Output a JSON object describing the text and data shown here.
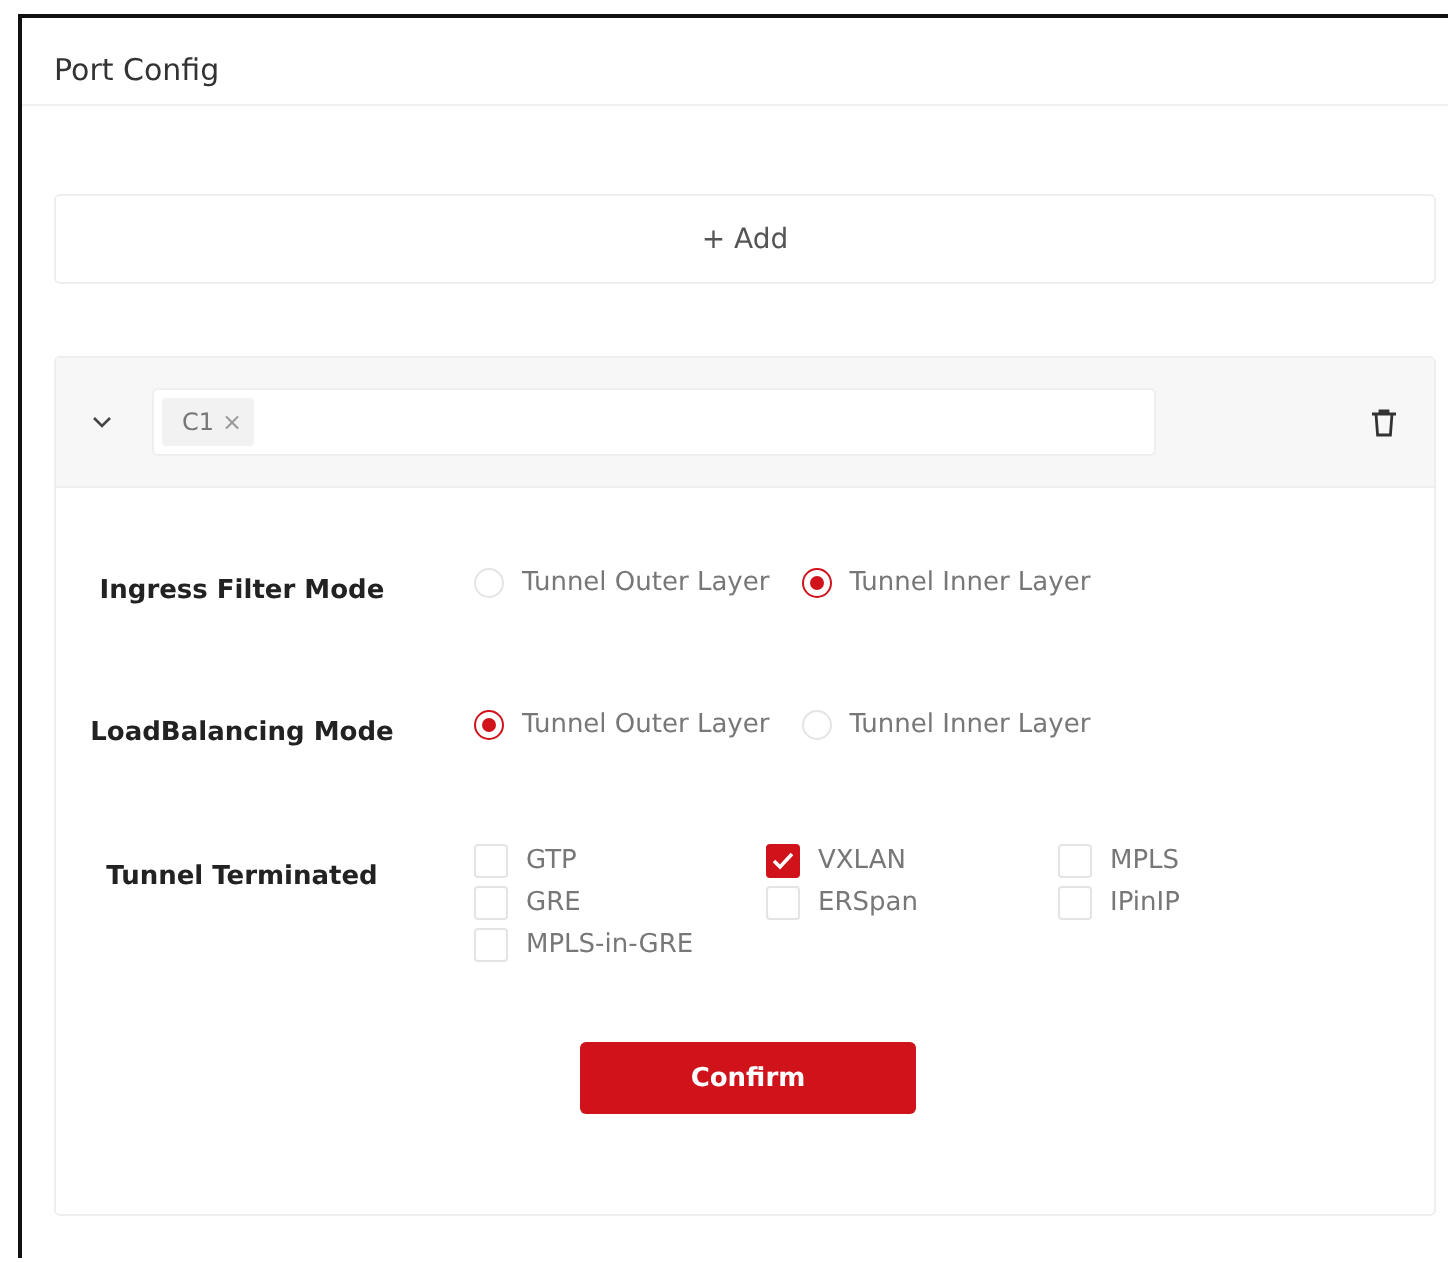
{
  "window": {
    "title": "Port Config"
  },
  "add_button": {
    "label": "+ Add"
  },
  "port_card": {
    "expanded": true,
    "tags": [
      {
        "label": "C1",
        "remove": "×"
      }
    ],
    "fields": [
      {
        "kind": "radio",
        "label": "Ingress Filter Mode",
        "options": [
          {
            "label": "Tunnel Outer Layer",
            "selected": false
          },
          {
            "label": "Tunnel Inner Layer",
            "selected": true
          }
        ]
      },
      {
        "kind": "radio",
        "label": "LoadBalancing Mode",
        "options": [
          {
            "label": "Tunnel Outer Layer",
            "selected": true
          },
          {
            "label": "Tunnel Inner Layer",
            "selected": false
          }
        ]
      },
      {
        "kind": "checkbox",
        "label": "Tunnel Terminated",
        "options": [
          {
            "label": "GTP",
            "checked": false
          },
          {
            "label": "VXLAN",
            "checked": true
          },
          {
            "label": "MPLS",
            "checked": false
          },
          {
            "label": "GRE",
            "checked": false
          },
          {
            "label": "ERSpan",
            "checked": false
          },
          {
            "label": "IPinIP",
            "checked": false
          },
          {
            "label": "MPLS-in-GRE",
            "checked": false
          }
        ]
      }
    ],
    "confirm_button": {
      "label": "Confirm"
    }
  }
}
